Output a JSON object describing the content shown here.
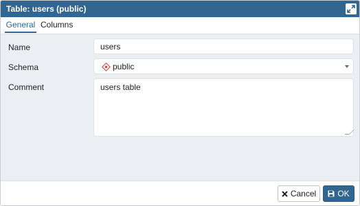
{
  "dialog": {
    "title": "Table: users (public)",
    "maximize_icon": "expand-arrows-icon"
  },
  "tabs": [
    {
      "label": "General",
      "active": true
    },
    {
      "label": "Columns",
      "active": false
    }
  ],
  "form": {
    "name_label": "Name",
    "name_value": "users",
    "schema_label": "Schema",
    "schema_value": "public",
    "schema_icon": "schema-icon",
    "comment_label": "Comment",
    "comment_value": "users table"
  },
  "footer": {
    "cancel_label": "Cancel",
    "cancel_icon": "x-icon",
    "ok_label": "OK",
    "ok_icon": "save-disk-icon"
  },
  "colors": {
    "accent": "#326690",
    "panel_bg": "#ebeef3",
    "schema_icon": "#dd3333"
  }
}
